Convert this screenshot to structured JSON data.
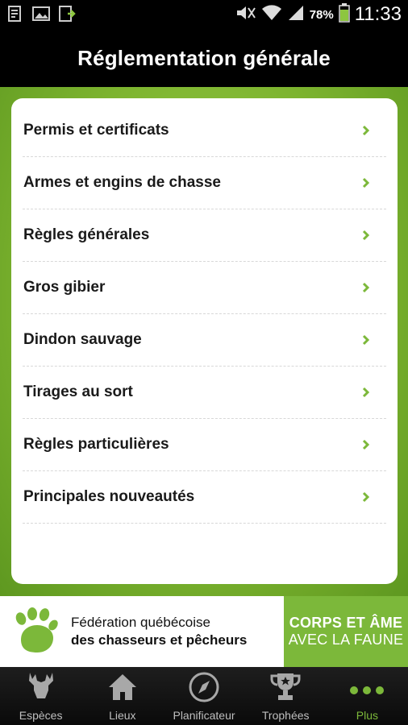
{
  "status_bar": {
    "battery": "78%",
    "time": "11:33",
    "icons": [
      "notification-icon",
      "image-icon",
      "download-icon",
      "mute-icon",
      "wifi-icon",
      "signal-icon",
      "battery-icon"
    ]
  },
  "header": {
    "title": "Réglementation générale"
  },
  "list": {
    "items": [
      {
        "label": "Permis et certificats"
      },
      {
        "label": "Armes et engins de chasse"
      },
      {
        "label": "Règles générales"
      },
      {
        "label": "Gros gibier"
      },
      {
        "label": "Dindon sauvage"
      },
      {
        "label": "Tirages au sort"
      },
      {
        "label": "Règles particulières"
      },
      {
        "label": "Principales nouveautés"
      }
    ]
  },
  "banner": {
    "line1": "Fédération québécoise",
    "line2": "des chasseurs et pêcheurs",
    "slogan_line1": "CORPS ET ÂME",
    "slogan_line2": "AVEC LA FAUNE"
  },
  "bottom_nav": {
    "items": [
      {
        "label": "Espèces",
        "icon": "deer-icon"
      },
      {
        "label": "Lieux",
        "icon": "house-icon"
      },
      {
        "label": "Planificateur",
        "icon": "compass-icon"
      },
      {
        "label": "Trophées",
        "icon": "trophy-icon"
      },
      {
        "label": "Plus",
        "icon": "more-icon",
        "active": true
      }
    ]
  },
  "colors": {
    "accent": "#7cb83a",
    "header_bg": "#000000"
  }
}
